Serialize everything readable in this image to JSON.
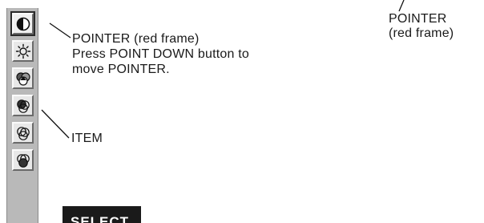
{
  "callouts": {
    "pointer_main": "POINTER (red frame)",
    "pointer_instruction_line1": "Press POINT DOWN button to",
    "pointer_instruction_line2": "move POINTER.",
    "item": "ITEM",
    "pointer_top_line1": "POINTER",
    "pointer_top_line2": "(red frame)"
  },
  "menu": {
    "items": [
      {
        "icon": "contrast-icon",
        "selected": true
      },
      {
        "icon": "brightness-icon",
        "selected": false
      },
      {
        "icon": "color-balance-icon",
        "selected": false
      },
      {
        "icon": "color-red-icon",
        "selected": false
      },
      {
        "icon": "color-green-icon",
        "selected": false
      },
      {
        "icon": "color-blue-icon",
        "selected": false
      }
    ],
    "select_label": "SELECT"
  }
}
